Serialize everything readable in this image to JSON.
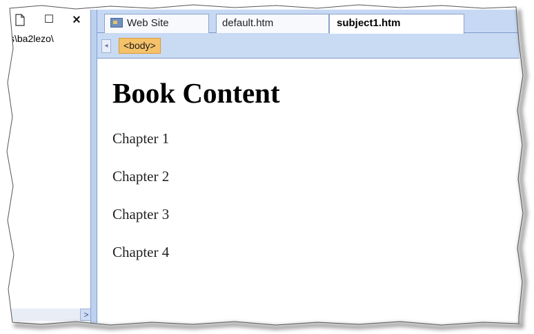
{
  "left_pane": {
    "path_text": "s\\ba2lezo\\",
    "toolbar_icons": [
      "document-icon",
      "maximize-icon",
      "close-icon"
    ],
    "close_glyph": "×",
    "maximize_glyph": "☐",
    "scroll_glyph": ">"
  },
  "tabs": [
    {
      "label": "Web Site",
      "icon": "website-icon",
      "active": false
    },
    {
      "label": "default.htm",
      "active": false
    },
    {
      "label": "subject1.htm",
      "active": true
    }
  ],
  "breadcrumb": {
    "tag": "<body>",
    "scroll_glyph": "◂"
  },
  "content": {
    "heading": "Book Content",
    "chapters": [
      "Chapter 1",
      "Chapter 2",
      "Chapter 3",
      "Chapter 4"
    ]
  },
  "colors": {
    "tab_strip": "#c6d8f4",
    "tag_highlight": "#f5c26a",
    "splitter": "#bcd1ef"
  }
}
